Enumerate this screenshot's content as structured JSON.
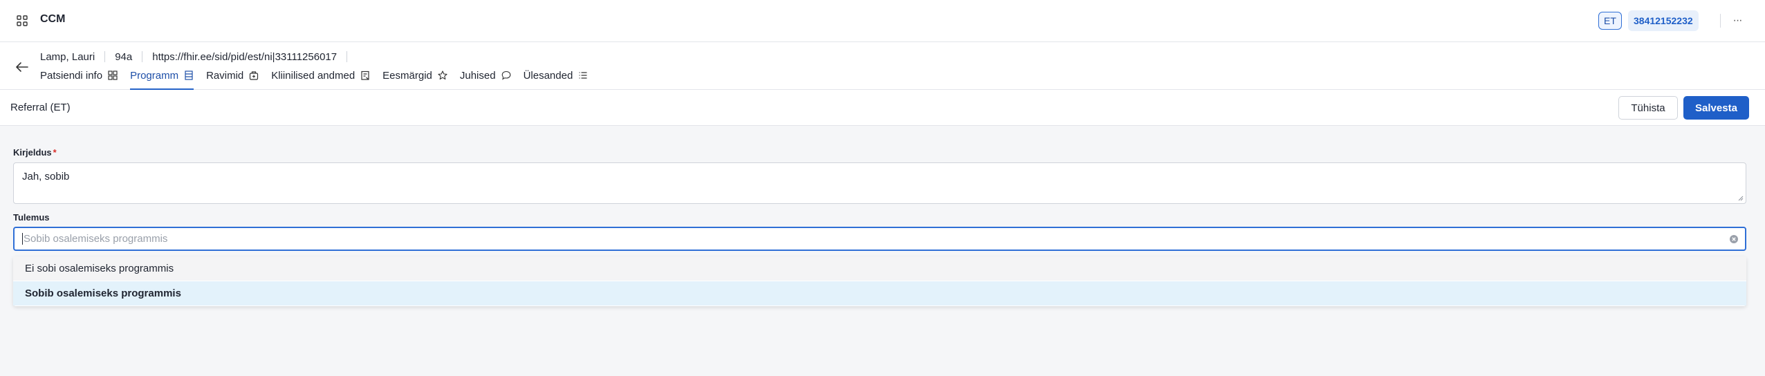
{
  "app": {
    "title": "CCM"
  },
  "topbar": {
    "language": "ET",
    "user_id": "38412152232"
  },
  "patient": {
    "name": "Lamp, Lauri",
    "age": "94a",
    "identifier": "https://fhir.ee/sid/pid/est/ni|33111256017"
  },
  "tabs": [
    {
      "label": "Patsiendi info",
      "icon": "grid-icon"
    },
    {
      "label": "Programm",
      "icon": "document-icon",
      "active": true
    },
    {
      "label": "Ravimid",
      "icon": "medicine-box-icon"
    },
    {
      "label": "Kliinilised andmed",
      "icon": "clipboard-icon"
    },
    {
      "label": "Eesmärgid",
      "icon": "star-icon"
    },
    {
      "label": "Juhised",
      "icon": "chat-bubble-icon"
    },
    {
      "label": "Ülesanded",
      "icon": "list-icon"
    }
  ],
  "form": {
    "title": "Referral (ET)",
    "cancel_label": "Tühista",
    "save_label": "Salvesta",
    "description_label": "Kirjeldus",
    "required_marker": "*",
    "description_value": "Jah, sobib",
    "result_label": "Tulemus",
    "result_placeholder": "Sobib osalemiseks programmis",
    "result_options": [
      "Ei sobi osalemiseks programmis",
      "Sobib osalemiseks programmis"
    ]
  },
  "colors": {
    "accent": "#1f5fc8",
    "highlight": "#e3f2fb",
    "required": "#d9302c"
  }
}
